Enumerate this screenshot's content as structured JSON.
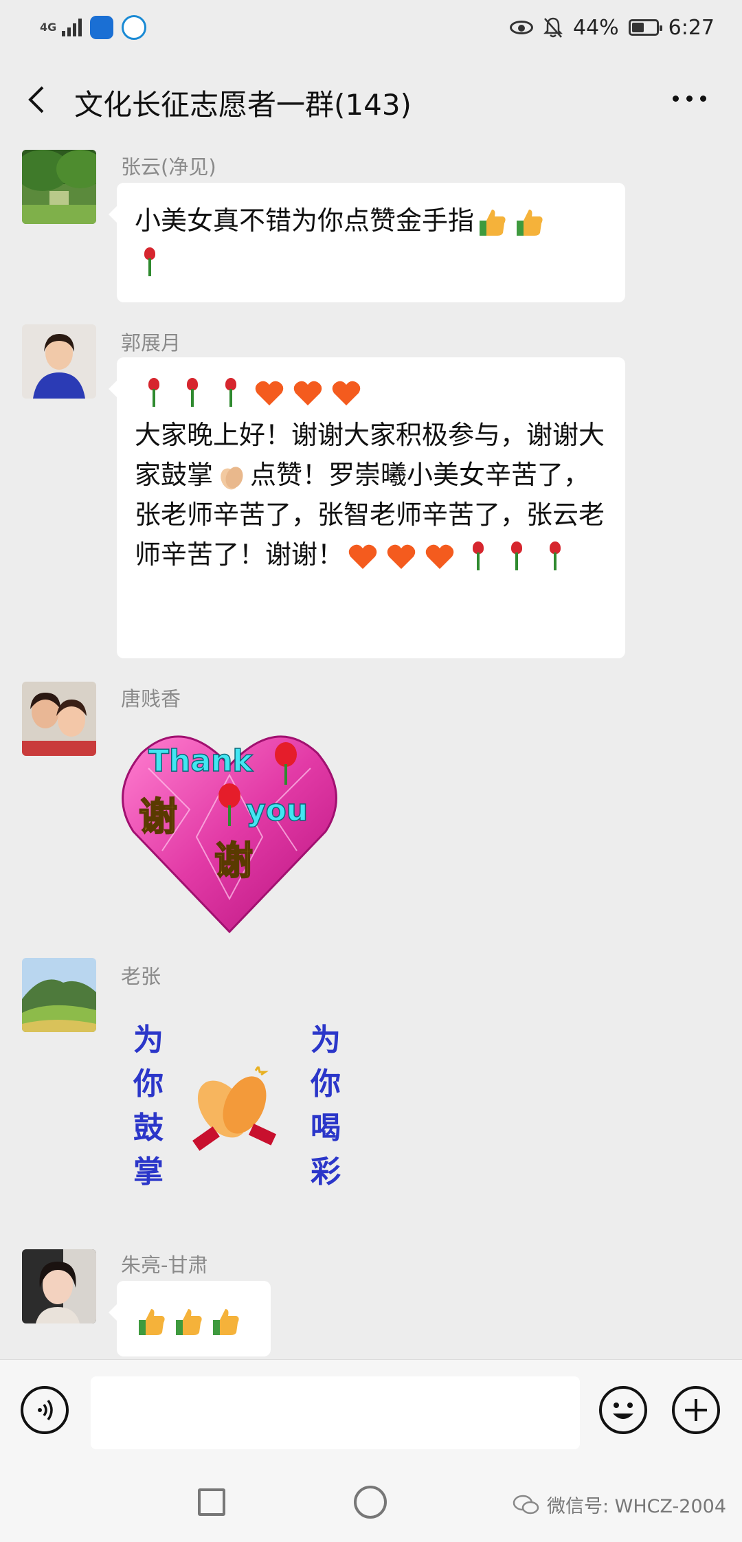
{
  "status_bar": {
    "network": "4G",
    "battery": "44%",
    "time": "6:27"
  },
  "header": {
    "title": "文化长征志愿者一群(143)"
  },
  "messages": [
    {
      "sender": "张云(净见)",
      "text": "小美女真不错为你点赞金手指"
    },
    {
      "sender": "郭展月",
      "text": "大家晚上好！谢谢大家积极参与，谢谢大家鼓掌",
      "text2": "点赞！罗崇曦小美女辛苦了，张老师辛苦了，张智老师辛苦了，张云老师辛苦了！谢谢！"
    },
    {
      "sender": "唐贱香",
      "sticker": {
        "line1": "Thank",
        "line2": "you",
        "line3": "谢",
        "line4": "谢"
      }
    },
    {
      "sender": "老张",
      "sticker": {
        "left": [
          "为",
          "你",
          "鼓",
          "掌"
        ],
        "right": [
          "为",
          "你",
          "喝",
          "彩"
        ]
      }
    },
    {
      "sender": "朱亮-甘肃"
    }
  ],
  "footer": {
    "watermark": "微信号: WHCZ-2004"
  },
  "icons": [
    "back-icon",
    "more-icon",
    "voice-icon",
    "emoji-icon",
    "plus-icon",
    "rose-icon",
    "heart-icon",
    "thumbs-up-icon",
    "clap-icon"
  ],
  "colors": {
    "background": "#ededed",
    "bubble": "#ffffff",
    "sender": "#8a8a8a",
    "sticker_text": "#2b36c9"
  }
}
